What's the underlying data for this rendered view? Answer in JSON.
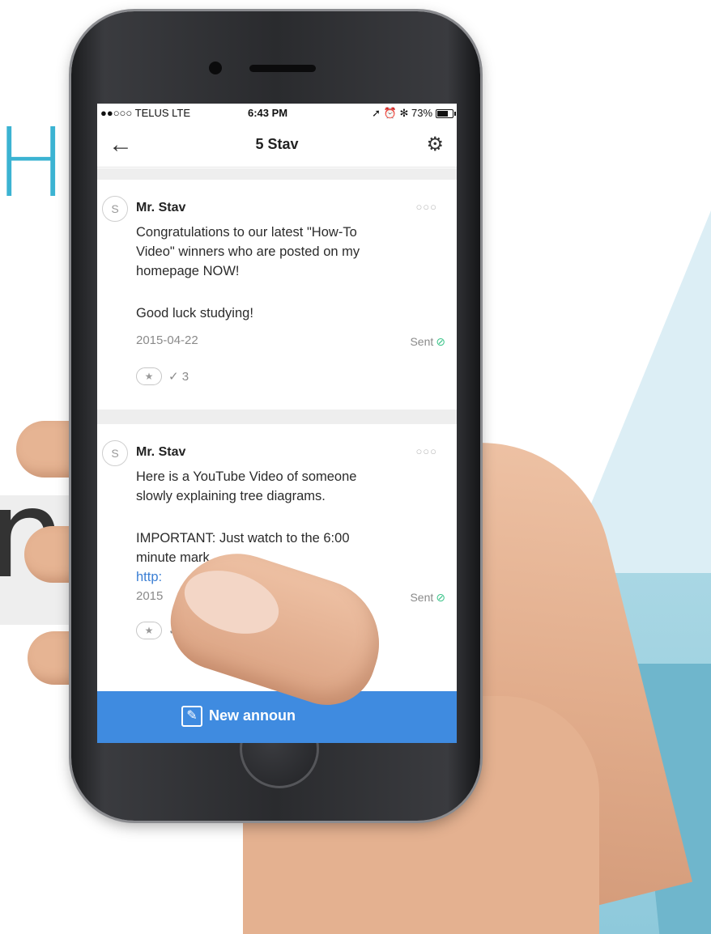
{
  "background": {
    "letters_top": "HE",
    "letters_mid": "ne"
  },
  "status_bar": {
    "carrier": "●●○○○ TELUS  LTE",
    "time": "6:43 PM",
    "icons": "➚ ⏰ ✻ 73%",
    "battery_percent": 73
  },
  "nav": {
    "back_icon": "←",
    "title": "5 Stav",
    "settings_icon": "⚙"
  },
  "posts": [
    {
      "avatar_letter": "S",
      "author": "Mr. Stav",
      "more_icon": "○○○",
      "lines": [
        "Congratulations to our latest \"How-To",
        "Video\" winners who are posted on my",
        "homepage NOW!",
        "",
        "Good luck studying!"
      ],
      "date": "2015-04-22",
      "status": "Sent",
      "status_icon": "⊘",
      "star_icon": "★",
      "check_count": "✓ 3"
    },
    {
      "avatar_letter": "S",
      "author": "Mr. Stav",
      "more_icon": "○○○",
      "lines": [
        "Here is a YouTube Video of someone",
        "slowly explaining tree diagrams.",
        "",
        "IMPORTANT: Just watch to the 6:00",
        "minute mark"
      ],
      "link": "http:",
      "date": "2015",
      "status": "Sent",
      "status_icon": "⊘",
      "star_icon": "★",
      "check_count": "✓"
    }
  ],
  "footer": {
    "new_announcement_icon": "✎",
    "new_announcement_label": "New announ"
  },
  "colors": {
    "accent": "#3f8be0",
    "sent_check": "#3cc48a",
    "link": "#3b7fd4",
    "bg_teal": "#8ec9db"
  }
}
